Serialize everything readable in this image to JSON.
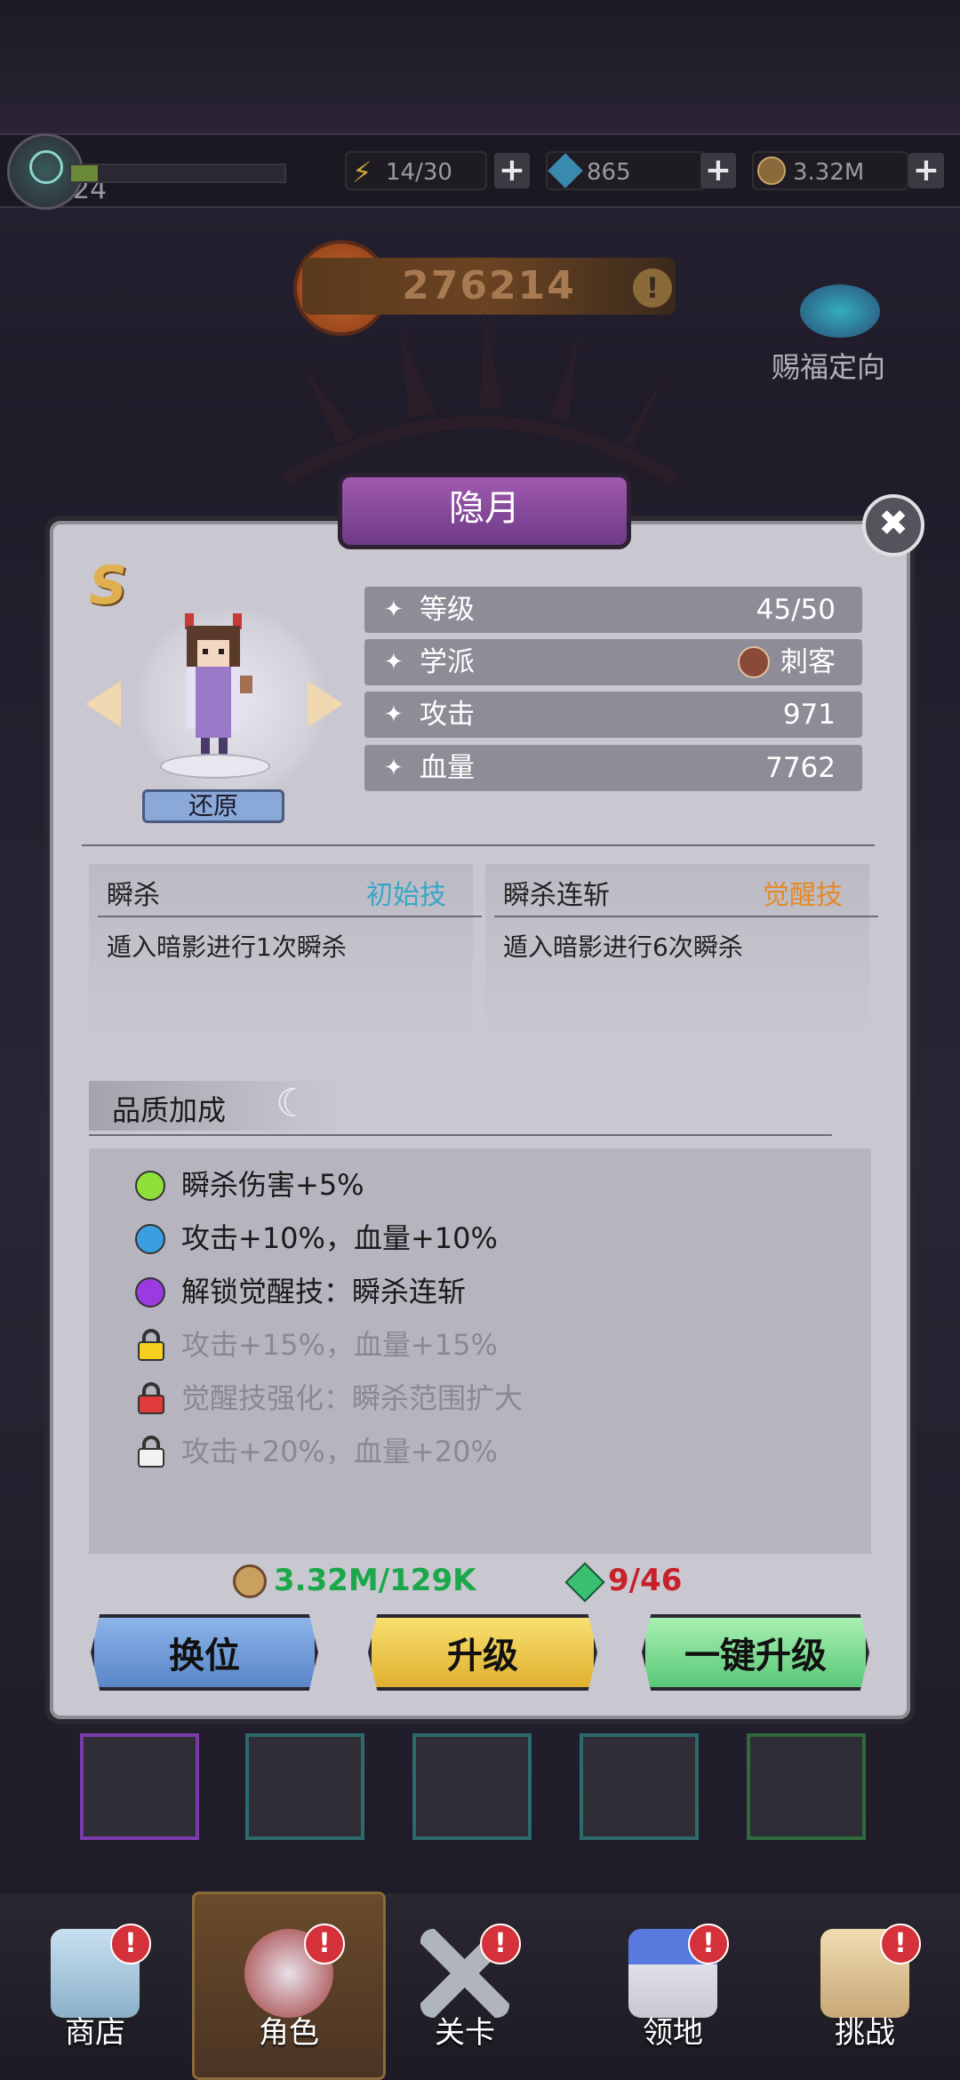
{
  "topbar": {
    "level": "24",
    "energy": "14/30",
    "gems": "865",
    "gold": "3.32M",
    "plus": "+"
  },
  "power": {
    "value": "276214",
    "info": "!"
  },
  "blessing": {
    "label": "赐福定向"
  },
  "character": {
    "name": "隐月",
    "rank": "S",
    "restore": "还原",
    "close": "✖",
    "stats": [
      {
        "label": "等级",
        "value": "45/50"
      },
      {
        "label": "学派",
        "value": "刺客"
      },
      {
        "label": "攻击",
        "value": "971"
      },
      {
        "label": "血量",
        "value": "7762"
      }
    ]
  },
  "skills": [
    {
      "name": "瞬杀",
      "type": "初始技",
      "desc": "遁入暗影进行1次瞬杀",
      "type_color": "#3aa6c8"
    },
    {
      "name": "瞬杀连斩",
      "type": "觉醒技",
      "desc": "遁入暗影进行6次瞬杀",
      "type_color": "#e58a25"
    }
  ],
  "quality": {
    "title": "品质加成",
    "items": [
      {
        "text": "瞬杀伤害+5%",
        "marker": "green-dot",
        "color": "#8fe03a",
        "active": true
      },
      {
        "text": "攻击+10%，血量+10%",
        "marker": "blue-dot",
        "color": "#3a9ee0",
        "active": true
      },
      {
        "text": "解锁觉醒技：瞬杀连斩",
        "marker": "purple-dot",
        "color": "#9a3ae0",
        "active": true
      },
      {
        "text": "攻击+15%，血量+15%",
        "marker": "lock-yellow",
        "color": "#f5d020",
        "active": false
      },
      {
        "text": "觉醒技强化：瞬杀范围扩大",
        "marker": "lock-red",
        "color": "#e03a3a",
        "active": false
      },
      {
        "text": "攻击+20%，血量+20%",
        "marker": "lock-white",
        "color": "#f2f2f2",
        "active": false
      }
    ]
  },
  "cost": {
    "gold": "3.32M/129K",
    "shard": "9/46"
  },
  "buttons": {
    "swap": "换位",
    "upgrade": "升级",
    "max_upgrade": "一键升级"
  },
  "nav": [
    {
      "label": "商店",
      "badge": "!"
    },
    {
      "label": "角色",
      "badge": "!"
    },
    {
      "label": "关卡",
      "badge": "!"
    },
    {
      "label": "领地",
      "badge": "!"
    },
    {
      "label": "挑战",
      "badge": "!"
    }
  ]
}
